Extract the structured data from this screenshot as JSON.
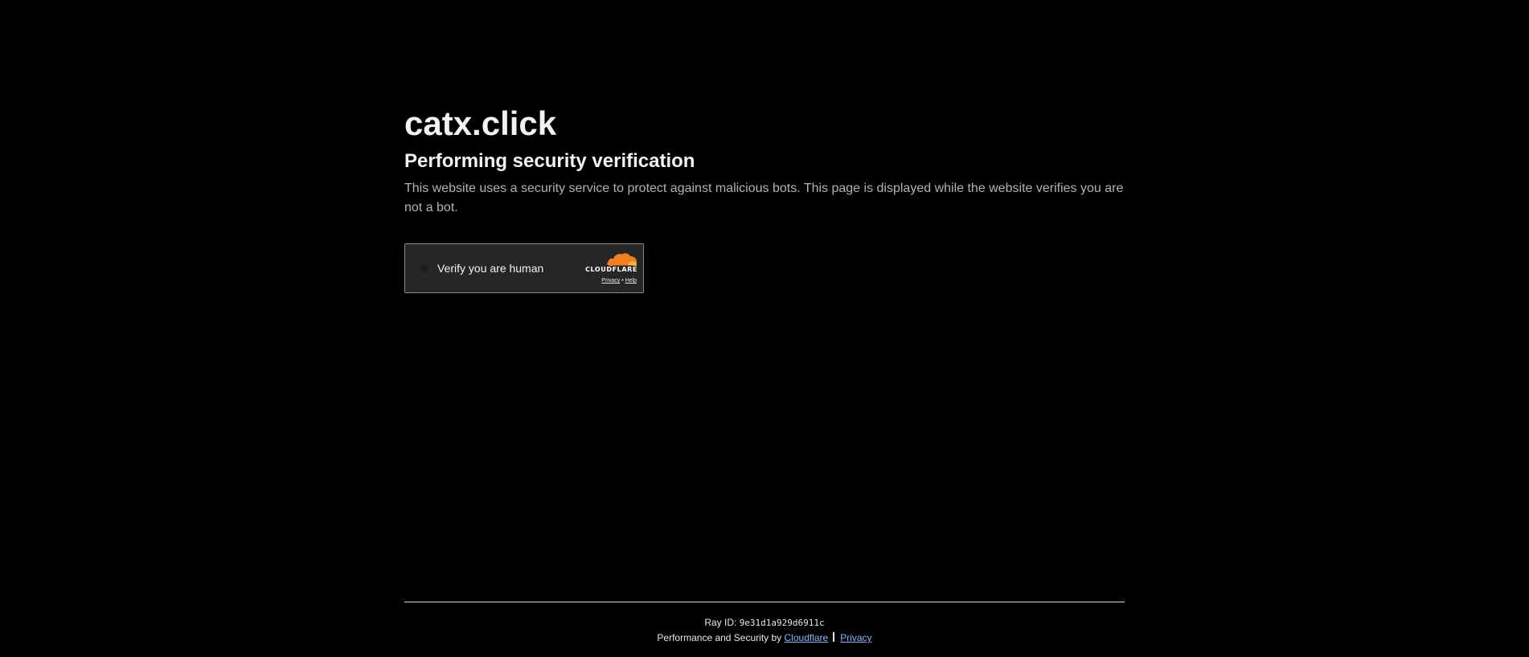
{
  "site": {
    "domain": "catx.click"
  },
  "challenge": {
    "heading": "Performing security verification",
    "description": "This website uses a security service to protect against malicious bots. This page is displayed while the website verifies you are not a bot."
  },
  "widget": {
    "label": "Verify you are human",
    "brand": "CLOUDFLARE",
    "privacy_link": "Privacy",
    "link_separator": "•",
    "help_link": "Help",
    "brand_color": "#f38020"
  },
  "footer": {
    "ray_label": "Ray ID:",
    "ray_id": "9e31d1a929d6911c",
    "performance_text": "Performance and Security by",
    "cloudflare_link": "Cloudflare",
    "privacy_link": "Privacy",
    "link_color": "#8ab4f8"
  }
}
